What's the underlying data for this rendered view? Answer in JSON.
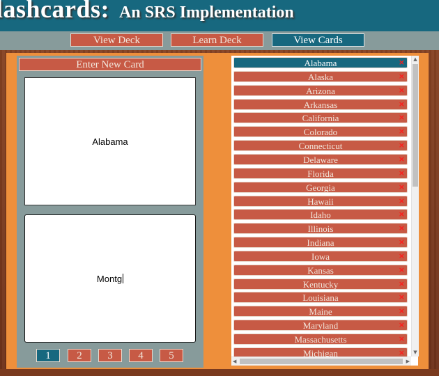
{
  "header": {
    "title_main": "lashcards:",
    "title_sub": "An SRS Implementation"
  },
  "nav": {
    "view_deck": "View Deck",
    "learn_deck": "Learn Deck",
    "view_cards": "View Cards"
  },
  "editor": {
    "enter_new_card": "Enter New Card",
    "front_text": "Alabama",
    "back_text": "Montg"
  },
  "pager": [
    "1",
    "2",
    "3",
    "4",
    "5"
  ],
  "pager_active": "1",
  "cards": [
    "Alabama",
    "Alaska",
    "Arizona",
    "Arkansas",
    "California",
    "Colorado",
    "Connecticut",
    "Delaware",
    "Florida",
    "Georgia",
    "Hawaii",
    "Idaho",
    "Illinois",
    "Indiana",
    "Iowa",
    "Kansas",
    "Kentucky",
    "Louisiana",
    "Maine",
    "Maryland",
    "Massachusetts",
    "Michigan"
  ],
  "selected_card": "Alabama",
  "delete_glyph": "×",
  "colors": {
    "accent_teal": "#17687f",
    "button_red": "#c75a45",
    "panel_orange": "#ee8f3b",
    "panel_gray": "#879b9b",
    "delete_red": "#ff1a1a"
  }
}
